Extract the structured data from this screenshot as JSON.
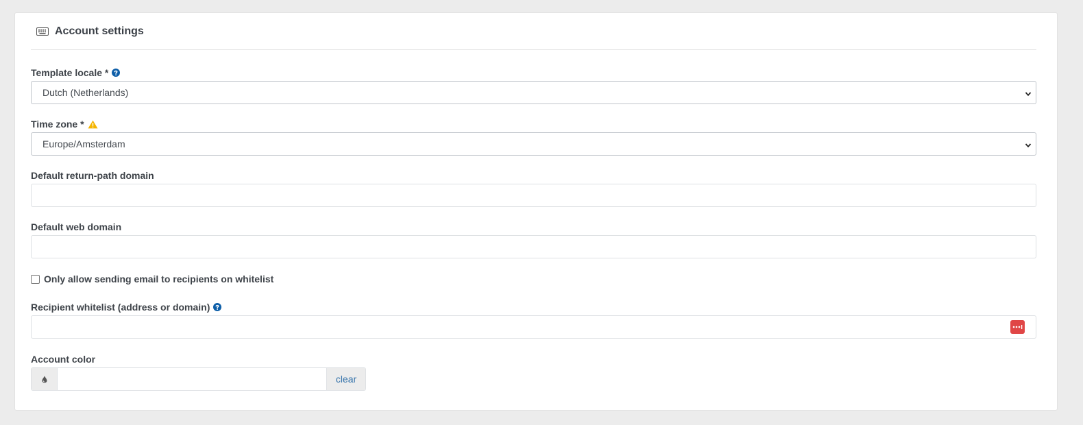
{
  "card": {
    "title": "Account settings",
    "icon": "keyboard-icon"
  },
  "fields": {
    "template_locale": {
      "label": "Template locale *",
      "value": "Dutch (Netherlands)",
      "icon": "help-icon"
    },
    "time_zone": {
      "label": "Time zone *",
      "value": "Europe/Amsterdam",
      "icon": "warning-icon"
    },
    "return_path_domain": {
      "label": "Default return-path domain",
      "value": ""
    },
    "web_domain": {
      "label": "Default web domain",
      "value": ""
    },
    "whitelist_only": {
      "label": "Only allow sending email to recipients on whitelist",
      "checked": false
    },
    "recipient_whitelist": {
      "label": "Recipient whitelist (address or domain)",
      "value": "",
      "icon": "help-icon"
    },
    "account_color": {
      "label": "Account color",
      "value": "",
      "clear_label": "clear",
      "icon": "droplet-icon"
    }
  },
  "colors": {
    "help": "#0d5ea8",
    "warning": "#f4b400",
    "password_manager": "#e04646",
    "link": "#2f6fa8"
  }
}
